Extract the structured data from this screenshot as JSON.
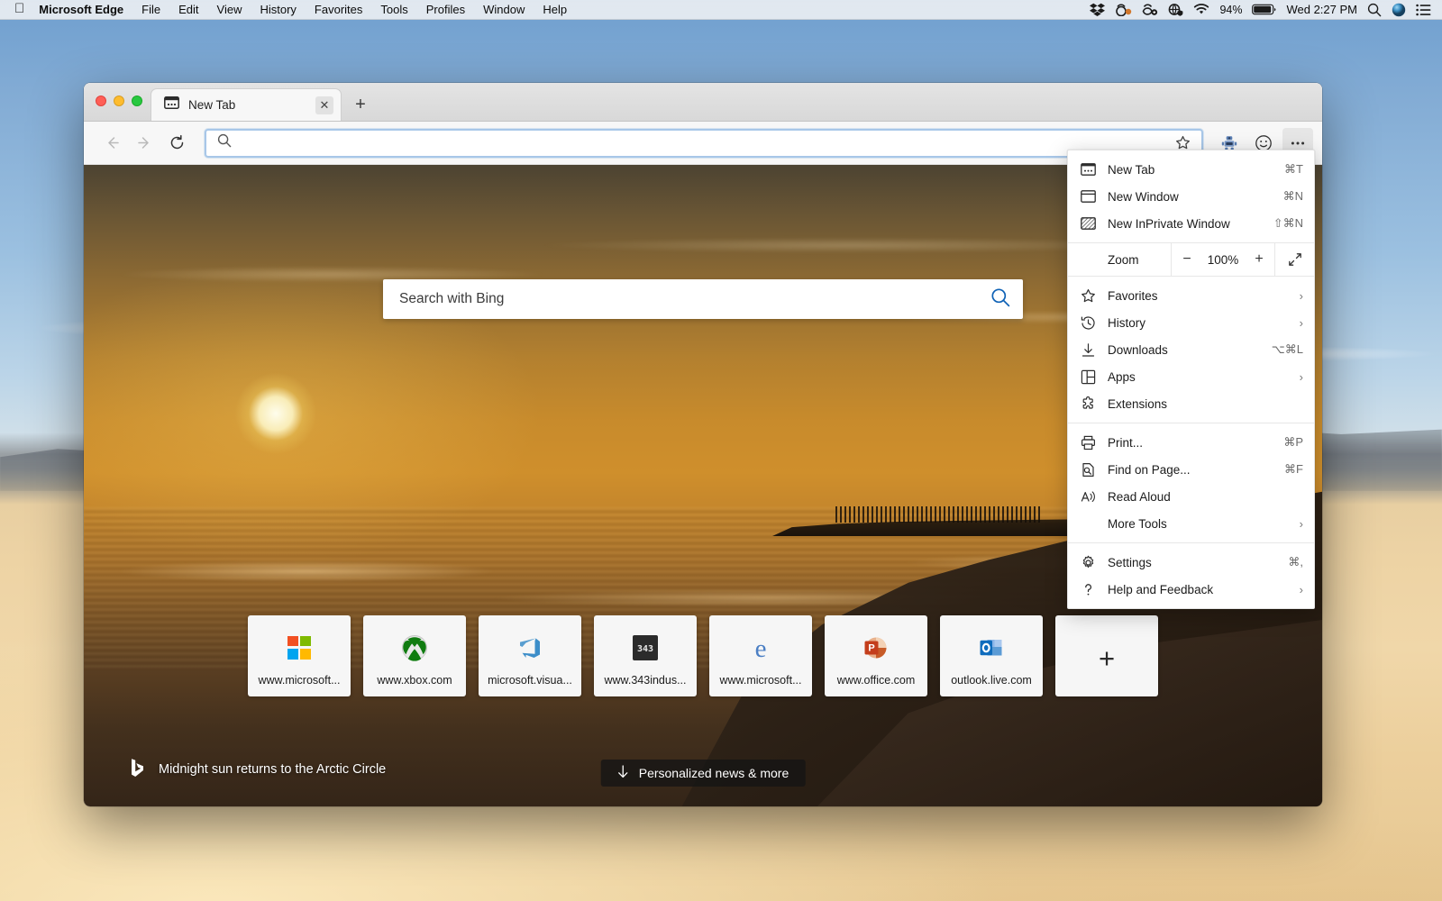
{
  "menubar": {
    "apple_icon": "apple-logo",
    "app_name": "Microsoft Edge",
    "items": [
      "File",
      "Edit",
      "View",
      "History",
      "Favorites",
      "Tools",
      "Profiles",
      "Window",
      "Help"
    ],
    "status_icons": [
      "dropbox-icon",
      "app-status-icon",
      "cloud-sync-icon",
      "shield-globe-icon",
      "wifi-icon"
    ],
    "battery_percent": "94%",
    "battery_icon": "battery-icon",
    "clock": "Wed 2:27 PM",
    "spotlight_icon": "search-icon",
    "siri_icon": "siri-icon",
    "control_center_icon": "list-icon"
  },
  "window": {
    "traffic_lights": [
      "close",
      "minimize",
      "maximize"
    ],
    "tab": {
      "favicon": "new-tab-icon",
      "title": "New Tab",
      "close_icon": "close-icon"
    },
    "new_tab_button": "+",
    "toolbar": {
      "back_icon": "back-arrow-icon",
      "forward_icon": "forward-arrow-icon",
      "reload_icon": "reload-icon",
      "address_search_icon": "search-icon",
      "address_value": "",
      "address_placeholder": "",
      "favorite_icon": "star-icon",
      "collections_icon": "collections-icon",
      "profile_icon": "smiley-icon",
      "more_icon": "ellipsis-icon"
    }
  },
  "newtab": {
    "search_placeholder": "Search with Bing",
    "search_icon": "search-icon",
    "tiles": [
      {
        "label": "www.microsoft...",
        "icon": "microsoft-logo-icon"
      },
      {
        "label": "www.xbox.com",
        "icon": "xbox-icon"
      },
      {
        "label": "microsoft.visua...",
        "icon": "azure-devops-icon"
      },
      {
        "label": "www.343indus...",
        "icon": "343-industries-icon"
      },
      {
        "label": "www.microsoft...",
        "icon": "edge-legacy-icon"
      },
      {
        "label": "www.office.com",
        "icon": "powerpoint-icon"
      },
      {
        "label": "outlook.live.com",
        "icon": "outlook-icon"
      }
    ],
    "add_tile": {
      "label": "+",
      "icon": "plus-icon"
    },
    "credit": {
      "icon": "bing-icon",
      "text": "Midnight sun returns to the Arctic Circle"
    },
    "news_button": {
      "icon": "down-arrow-icon",
      "label": "Personalized news & more"
    }
  },
  "edge_menu": {
    "groups": [
      {
        "items": [
          {
            "icon": "new-tab-icon",
            "label": "New Tab",
            "accel": "⌘T",
            "chevron": false
          },
          {
            "icon": "new-window-icon",
            "label": "New Window",
            "accel": "⌘N",
            "chevron": false
          },
          {
            "icon": "inprivate-window-icon",
            "label": "New InPrivate Window",
            "accel": "⇧⌘N",
            "chevron": false
          }
        ]
      },
      {
        "items": [
          {
            "icon": "star-icon",
            "label": "Favorites",
            "accel": "",
            "chevron": true
          },
          {
            "icon": "history-icon",
            "label": "History",
            "accel": "",
            "chevron": true
          },
          {
            "icon": "download-icon",
            "label": "Downloads",
            "accel": "⌥⌘L",
            "chevron": false
          },
          {
            "icon": "apps-icon",
            "label": "Apps",
            "accel": "",
            "chevron": true
          },
          {
            "icon": "extensions-icon",
            "label": "Extensions",
            "accel": "",
            "chevron": false
          }
        ]
      },
      {
        "items": [
          {
            "icon": "print-icon",
            "label": "Print...",
            "accel": "⌘P",
            "chevron": false
          },
          {
            "icon": "find-icon",
            "label": "Find on Page...",
            "accel": "⌘F",
            "chevron": false
          },
          {
            "icon": "read-aloud-icon",
            "label": "Read Aloud",
            "accel": "",
            "chevron": false
          },
          {
            "icon": "",
            "label": "More Tools",
            "accel": "",
            "chevron": true
          }
        ]
      },
      {
        "items": [
          {
            "icon": "gear-icon",
            "label": "Settings",
            "accel": "⌘,",
            "chevron": false
          },
          {
            "icon": "help-icon",
            "label": "Help and Feedback",
            "accel": "",
            "chevron": true
          }
        ]
      }
    ],
    "zoom": {
      "label": "Zoom",
      "minus": "−",
      "value": "100%",
      "plus": "+",
      "fullscreen_icon": "fullscreen-icon"
    }
  },
  "colors": {
    "menu_bg": "#ffffff",
    "toolbar_bg": "#f7f7f7",
    "omnibox_focus": "#a8c7e8",
    "bing_blue": "#0f62b6",
    "accent_text": "#1b1b1b"
  }
}
